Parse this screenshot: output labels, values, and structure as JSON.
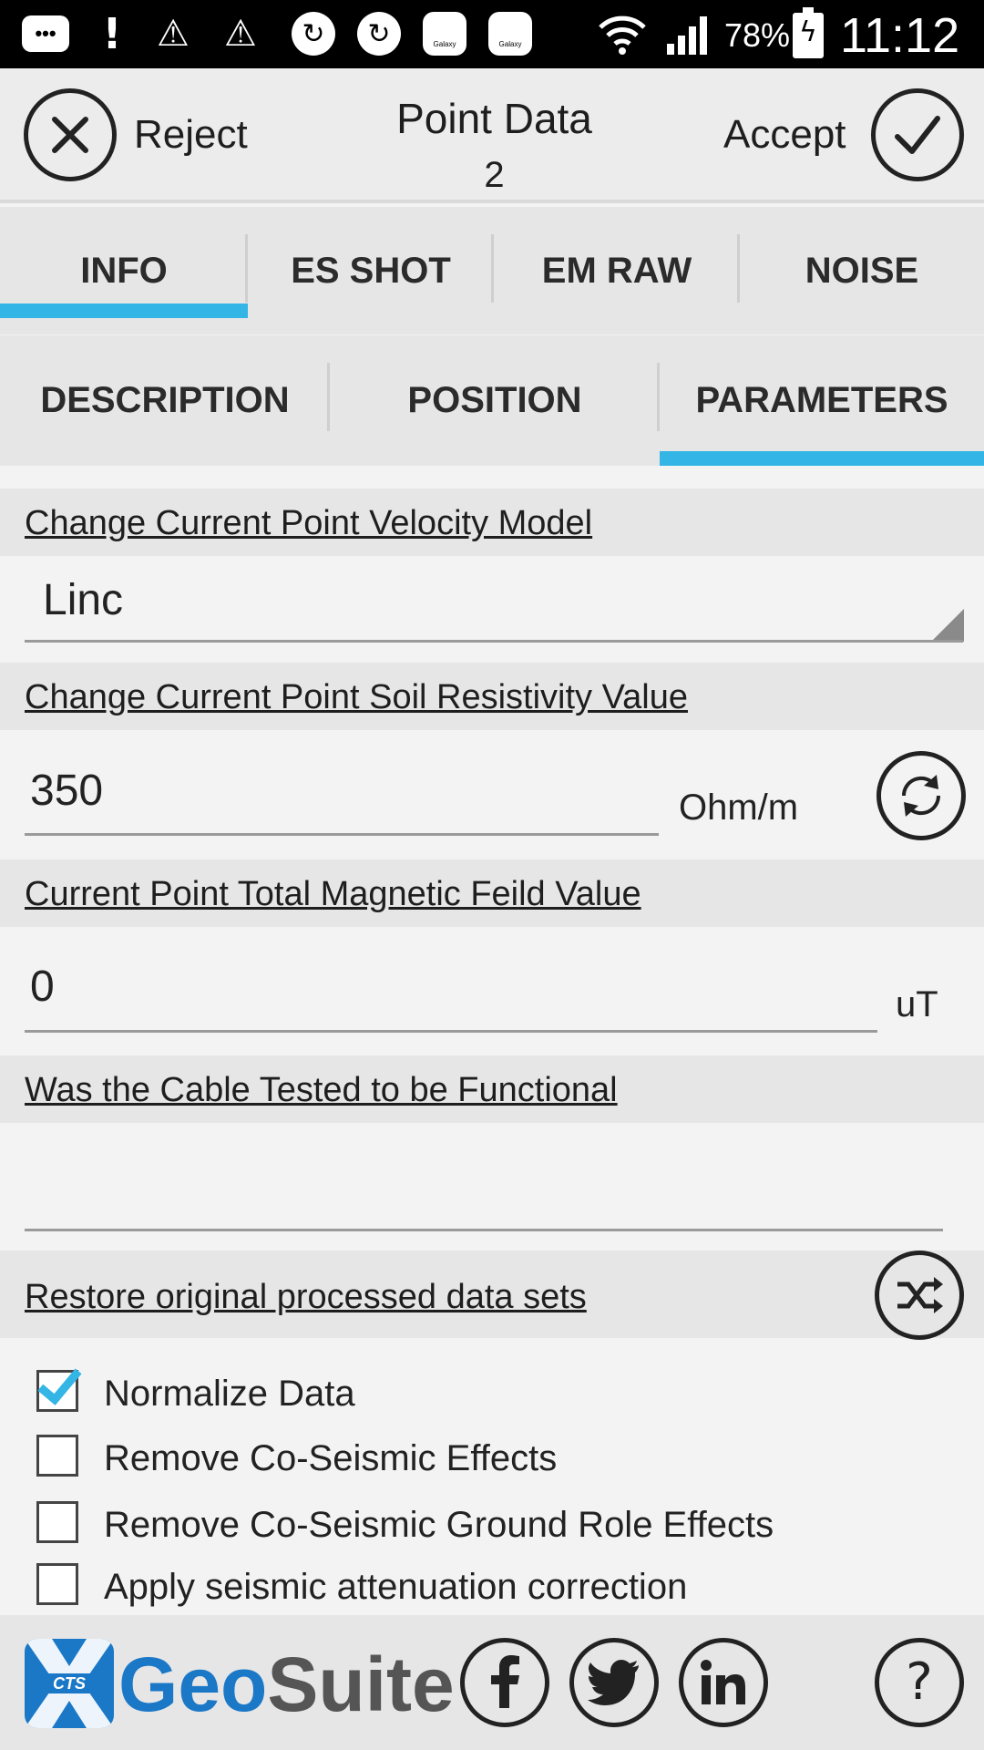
{
  "status_bar": {
    "notification_icons": [
      "message-icon",
      "alert-icon",
      "warning-icon",
      "warning-icon",
      "sync-icon",
      "sync-icon",
      "galaxy-icon",
      "galaxy-icon"
    ],
    "battery_percent": "78%",
    "time": "11:12"
  },
  "header": {
    "reject_label": "Reject",
    "accept_label": "Accept",
    "title": "Point Data",
    "subtitle": "2"
  },
  "tabs_primary": [
    {
      "label": "INFO",
      "selected": true
    },
    {
      "label": "ES SHOT",
      "selected": false
    },
    {
      "label": "EM RAW",
      "selected": false
    },
    {
      "label": "NOISE",
      "selected": false
    }
  ],
  "tabs_secondary": [
    {
      "label": "DESCRIPTION",
      "selected": false
    },
    {
      "label": "POSITION",
      "selected": false
    },
    {
      "label": "PARAMETERS",
      "selected": true
    }
  ],
  "velocity_model": {
    "header": "Change Current Point Velocity Model",
    "value": "Linc"
  },
  "soil_resistivity": {
    "header": "Change Current Point Soil Resistivity Value",
    "value": "350",
    "unit": "Ohm/m"
  },
  "magnetic_field": {
    "header": "Current Point Total Magnetic Feild Value",
    "value": "0",
    "unit": "uT"
  },
  "cable_test": {
    "header": "Was the Cable Tested to be Functional",
    "value": ""
  },
  "restore": {
    "header": "Restore original processed data sets"
  },
  "options": [
    {
      "label": "Normalize Data",
      "checked": true
    },
    {
      "label": "Remove Co-Seismic Effects",
      "checked": false
    },
    {
      "label": "Remove Co-Seismic Ground Role Effects",
      "checked": false
    },
    {
      "label": "Apply seismic attenuation correction",
      "checked": false
    }
  ],
  "footer": {
    "logo_badge": "CTS",
    "logo_geo": "Geo",
    "logo_suite": "Suite",
    "icons": [
      "facebook-icon",
      "twitter-icon",
      "linkedin-icon",
      "help-icon"
    ]
  },
  "colors": {
    "accent": "#33b5e5",
    "brand_blue": "#1b78c7"
  }
}
